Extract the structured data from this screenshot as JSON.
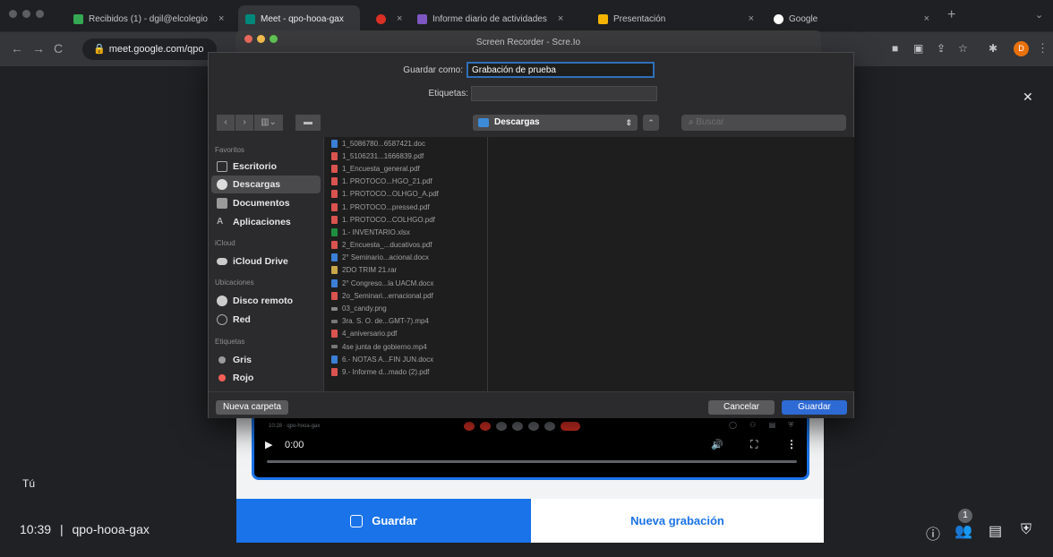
{
  "browser": {
    "tabs": [
      {
        "label": "Recibidos (1) - dgil@elcolegio",
        "color": "#34a853"
      },
      {
        "label": "Meet - qpo-hooa-gax",
        "color": "#00897b"
      },
      {
        "label": "",
        "color": "#d93025"
      },
      {
        "label": "Informe diario de actividades",
        "color": "#7e57c2"
      },
      {
        "label": "Presentación",
        "color": "#f4b400"
      },
      {
        "label": "Google",
        "color": "#ffffff"
      }
    ],
    "close_glyph": "×",
    "new_tab_glyph": "+",
    "url": "meet.google.com/qpo",
    "profile_initial": "D"
  },
  "recorder": {
    "window_title": "Screen Recorder - Scre.Io",
    "video_meeting_label": "10:28 · qpo-hooa-gax",
    "video_time": "0:00",
    "save_button": "Guardar",
    "new_recording_button": "Nueva grabación"
  },
  "save_dialog": {
    "save_as_label": "Guardar como:",
    "save_as_value": "Grabación de prueba",
    "tags_label": "Etiquetas:",
    "location": "Descargas",
    "search_placeholder": "Buscar",
    "sidebar": {
      "favorites_header": "Favoritos",
      "favorites": [
        "Escritorio",
        "Descargas",
        "Documentos",
        "Aplicaciones"
      ],
      "icloud_header": "iCloud",
      "icloud": [
        "iCloud Drive"
      ],
      "locations_header": "Ubicaciones",
      "locations": [
        "Disco remoto",
        "Red"
      ],
      "tags_header": "Etiquetas",
      "tags": [
        "Gris",
        "Rojo"
      ]
    },
    "files": [
      {
        "name": "1_5086780...6587421.doc",
        "icon": "word-icon"
      },
      {
        "name": "1_5106231...1666839.pdf",
        "icon": "pdf-icon"
      },
      {
        "name": "1_Encuesta_general.pdf",
        "icon": "pdf-icon"
      },
      {
        "name": "1. PROTOCO...HGO_21.pdf",
        "icon": "pdf-icon"
      },
      {
        "name": "1. PROTOCO...OLHGO_A.pdf",
        "icon": "pdf-icon"
      },
      {
        "name": "1. PROTOCO...pressed.pdf",
        "icon": "pdf-icon"
      },
      {
        "name": "1. PROTOCO...COLHGO.pdf",
        "icon": "pdf-icon"
      },
      {
        "name": "1.- INVENTARIO.xlsx",
        "icon": "excel-icon"
      },
      {
        "name": "2_Encuesta_...ducativos.pdf",
        "icon": "pdf-icon"
      },
      {
        "name": "2° Seminario...acional.docx",
        "icon": "word-icon"
      },
      {
        "name": "2DO TRIM 21.rar",
        "icon": "archive-icon"
      },
      {
        "name": "2° Congreso...la UACM.docx",
        "icon": "word-icon"
      },
      {
        "name": "2o_Seminari...ernacional.pdf",
        "icon": "pdf-icon"
      },
      {
        "name": "03_candy.png",
        "icon": "image-icon"
      },
      {
        "name": "3ra. S. O. de...GMT-7).mp4",
        "icon": "video-icon"
      },
      {
        "name": "4_aniversario.pdf",
        "icon": "pdf-icon"
      },
      {
        "name": "4se junta de gobierno.mp4",
        "icon": "video-icon"
      },
      {
        "name": "6.- NOTAS A...FIN JUN.docx",
        "icon": "word-icon"
      },
      {
        "name": "9.- Informe d...mado (2).pdf",
        "icon": "pdf-icon"
      }
    ],
    "new_folder_button": "Nueva carpeta",
    "cancel_button": "Cancelar",
    "save_button": "Guardar"
  },
  "meet": {
    "self_label": "Tú",
    "time": "10:39",
    "separator": "|",
    "meeting_code": "qpo-hooa-gax",
    "participants_badge": "1"
  }
}
